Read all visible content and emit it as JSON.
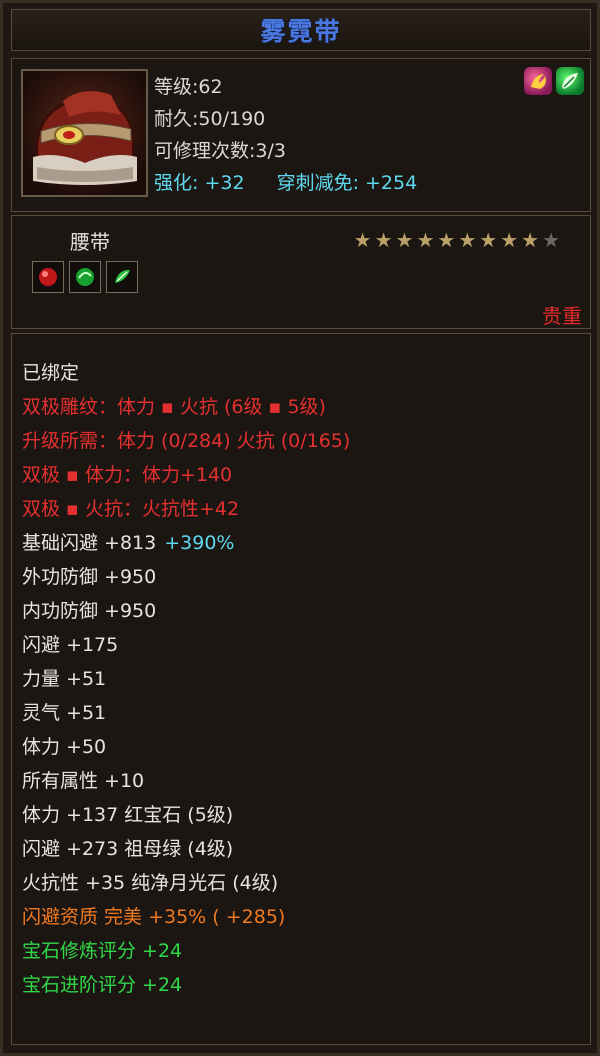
{
  "item": {
    "name": "雾霓带",
    "level_label": "等级",
    "level_value": ":62",
    "durability_label": "耐久",
    "durability_value": ":50/190",
    "repair_label": "可修理次数",
    "repair_value": ":3/3",
    "enhance_label": "强化:",
    "enhance_value": "+32",
    "pierce_label": "穿刺减免:",
    "pierce_value": "+254"
  },
  "meta": {
    "type": "腰带",
    "stars_filled": 9,
    "stars_total": 10,
    "rarity": "贵重"
  },
  "colors": {
    "title": "#4a78e0",
    "cyan": "#5ed9f0",
    "red": "#e43030",
    "orange": "#f07a20",
    "green": "#30d848"
  },
  "attributes": [
    {
      "text": "已绑定",
      "color": "white"
    },
    {
      "text": "双极雕纹：体力 ▪ 火抗 (6级 ▪ 5级)",
      "color": "red"
    },
    {
      "text": "升级所需：体力 (0/284)   火抗 (0/165)",
      "color": "red"
    },
    {
      "text": "双极 ▪ 体力：体力+140",
      "color": "red"
    },
    {
      "text": "双极 ▪ 火抗：火抗性+42",
      "color": "red"
    },
    {
      "text": "基础闪避 +813",
      "extra": "+390%",
      "color": "white"
    },
    {
      "text": "外功防御 +950",
      "color": "white"
    },
    {
      "text": "内功防御 +950",
      "color": "white"
    },
    {
      "text": "闪避 +175",
      "color": "white"
    },
    {
      "text": "力量 +51",
      "color": "white"
    },
    {
      "text": "灵气 +51",
      "color": "white"
    },
    {
      "text": "体力 +50",
      "color": "white"
    },
    {
      "text": "所有属性 +10",
      "color": "white"
    },
    {
      "text": "体力 +137  红宝石 (5级)",
      "color": "white"
    },
    {
      "text": "闪避 +273  祖母绿 (4级)",
      "color": "white"
    },
    {
      "text": "火抗性 +35  纯净月光石 (4级)",
      "color": "white"
    },
    {
      "text": "闪避资质   完美 +35% ( +285)",
      "color": "orange"
    },
    {
      "text": "宝石修炼评分 +24",
      "color": "green"
    },
    {
      "text": "宝石进阶评分 +24",
      "color": "green"
    }
  ]
}
